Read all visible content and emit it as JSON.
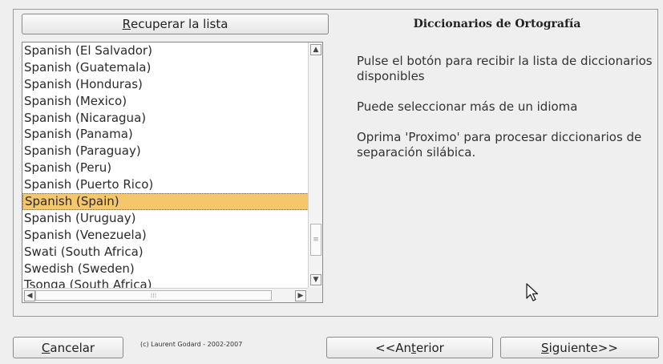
{
  "recuperar_button": {
    "before": "",
    "accel": "R",
    "after": "ecuperar la lista"
  },
  "list": {
    "items": [
      "Spanish (El Salvador)",
      "Spanish (Guatemala)",
      "Spanish (Honduras)",
      "Spanish (Mexico)",
      "Spanish (Nicaragua)",
      "Spanish (Panama)",
      "Spanish (Paraguay)",
      "Spanish (Peru)",
      "Spanish (Puerto Rico)",
      "Spanish (Spain)",
      "Spanish (Uruguay)",
      "Spanish (Venezuela)",
      "Swati (South Africa)",
      "Swedish (Sweden)",
      "Tsonga (South Africa)"
    ],
    "selected_index": 9,
    "selected_color": "#f5c66c"
  },
  "panel": {
    "title": "Diccionarios de Ortografía",
    "info1": "Pulse el botón para recibir la lista de diccionarios disponibles",
    "info2": "Puede seleccionar más de un idioma",
    "info3": "Oprima 'Proximo' para procesar diccionarios de separación silábica."
  },
  "footer": {
    "cancel": {
      "before": "",
      "accel": "C",
      "after": "ancelar"
    },
    "copyright": "(c) Laurent Godard - 2002-2007",
    "previous": {
      "before": "<<An",
      "accel": "t",
      "after": "erior"
    },
    "next": {
      "before": "",
      "accel": "S",
      "after": "iguiente>>"
    }
  },
  "icons": {
    "scroll_up": "▲",
    "scroll_down": "▼",
    "scroll_left": "◀",
    "scroll_right": "▶",
    "cursor": "mouse-pointer"
  }
}
